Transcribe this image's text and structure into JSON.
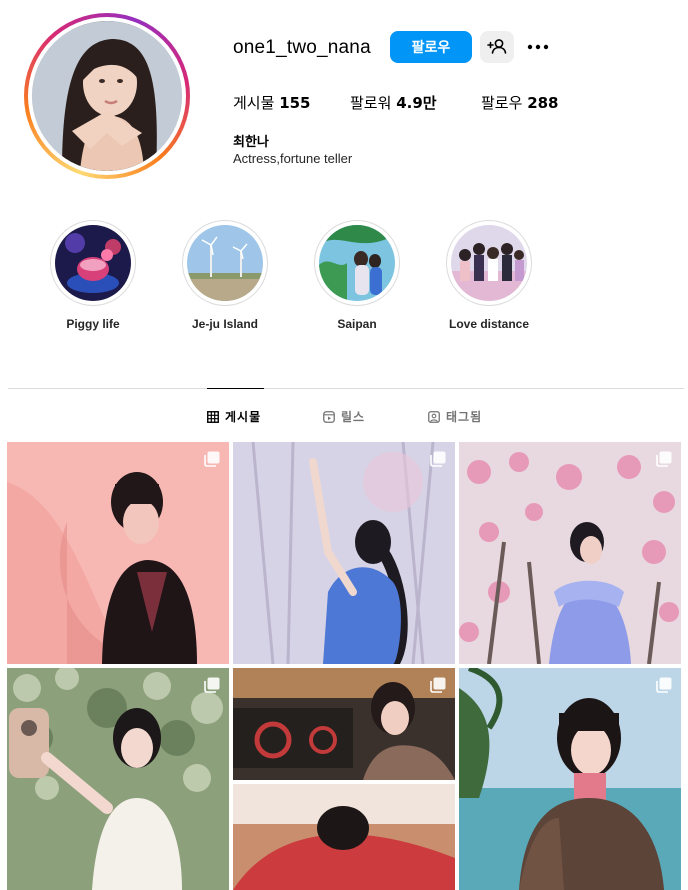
{
  "profile": {
    "username": "one1_two_nana",
    "follow_label": "팔로우",
    "posts_label": "게시물",
    "posts_count": "155",
    "followers_label": "팔로워",
    "followers_count": "4.9만",
    "following_label": "팔로우",
    "following_count": "288",
    "full_name": "최한나",
    "bio": "Actress,fortune teller"
  },
  "highlights": [
    {
      "label": "Piggy life"
    },
    {
      "label": "Je-ju Island"
    },
    {
      "label": "Saipan"
    },
    {
      "label": "Love distance"
    }
  ],
  "tabs": [
    {
      "label": "게시물",
      "icon": "grid-icon",
      "active": true
    },
    {
      "label": "릴스",
      "icon": "reels-icon",
      "active": false
    },
    {
      "label": "태그됨",
      "icon": "tagged-icon",
      "active": false
    }
  ],
  "posts": [
    {
      "icon": "carousel-icon"
    },
    {
      "icon": "carousel-icon"
    },
    {
      "icon": "carousel-icon"
    },
    {
      "icon": "carousel-icon"
    },
    {
      "icon": "carousel-icon"
    },
    {
      "icon": "carousel-icon"
    }
  ],
  "colors": {
    "accent": "#0095f6",
    "secondary_button": "#efefef",
    "divider": "#dbdbdb",
    "muted_text": "#737373"
  }
}
